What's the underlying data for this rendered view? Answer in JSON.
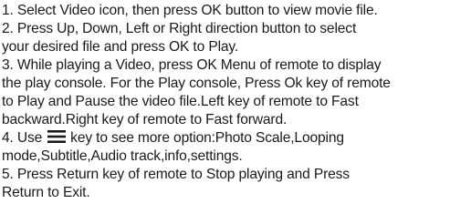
{
  "instructions": {
    "lines": [
      "1. Select Video icon, then press OK button to view movie file.",
      "2. Press Up, Down, Left or Right direction button to select",
      "your desired file and press OK to Play.",
      "3. While playing a Video, press OK Menu of remote to display",
      "the play console. For the Play console, Press Ok key of remote",
      "to Play and Pause the video file.Left key of remote to Fast",
      "backward.Right key of remote to Fast forward.",
      "",
      "mode,Subtitle,Audio track,info,settings.",
      "5. Press Return key of remote to Stop playing and Press",
      "Return to Exit."
    ],
    "line_4_prefix": "4. Use",
    "line_4_suffix": "key to see more option:Photo Scale,Looping",
    "menu_icon": "menu-icon"
  }
}
